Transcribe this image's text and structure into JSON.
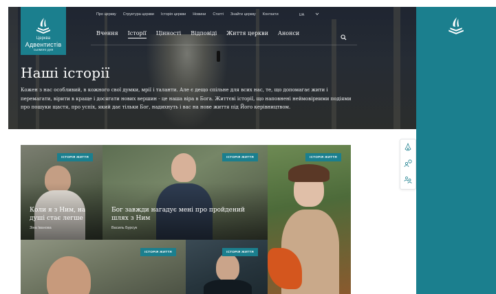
{
  "logo": {
    "line1": "Церква",
    "line2": "Адвентистів",
    "line3": "сьомого дня"
  },
  "topnav": [
    "Про церкву",
    "Структура церкви",
    "Історія церкви",
    "Новини",
    "Статті",
    "Знайти церкву",
    "Контакти"
  ],
  "language": "UA",
  "mainnav": [
    {
      "label": "Вчення",
      "active": false
    },
    {
      "label": "Історії",
      "active": true
    },
    {
      "label": "Цінності",
      "active": false
    },
    {
      "label": "Відповіді",
      "active": false
    },
    {
      "label": "Життя церкви",
      "active": false
    },
    {
      "label": "Анонси",
      "active": false
    }
  ],
  "hero": {
    "title": "Наші історії",
    "lead": "Кожен з нас особливий, в кожного свої думки, мрії і таланти. Але є дещо спільне для всих нас, те, що допомагає жити і перемагати, вірити в краще і досягати нових вершин - це наша віра в Бога. Життєві історії, що наповнені неймовірними подіями про пошуки щастя, про успіх, який дає тільки Бог, надихнуть і вас на нове життя під Його керівництвом."
  },
  "cards": [
    {
      "tag": "ІСТОРІЯ ЖИТТЯ",
      "title": "Коли я з Ним, на душі стає легше",
      "author": "Зіна Іванова"
    },
    {
      "tag": "ІСТОРІЯ ЖИТТЯ",
      "title": "Бог завжди нагадує мені про пройдений шлях з Ним",
      "author": "Василь Бурсук"
    },
    {
      "tag": "ІСТОРІЯ ЖИТТЯ",
      "title": "",
      "author": ""
    },
    {
      "tag": "ІСТОРІЯ ЖИТТЯ",
      "title": "",
      "author": ""
    },
    {
      "tag": "ІСТОРІЯ ЖИТТЯ",
      "title": "",
      "author": ""
    }
  ],
  "colors": {
    "brand": "#1b7f8e",
    "hero_bg": "#262c34"
  },
  "icons": [
    "church-logo-icon",
    "chevron-down-icon",
    "search-icon",
    "praying-hands-icon",
    "people-chat-icon",
    "group-icon"
  ]
}
